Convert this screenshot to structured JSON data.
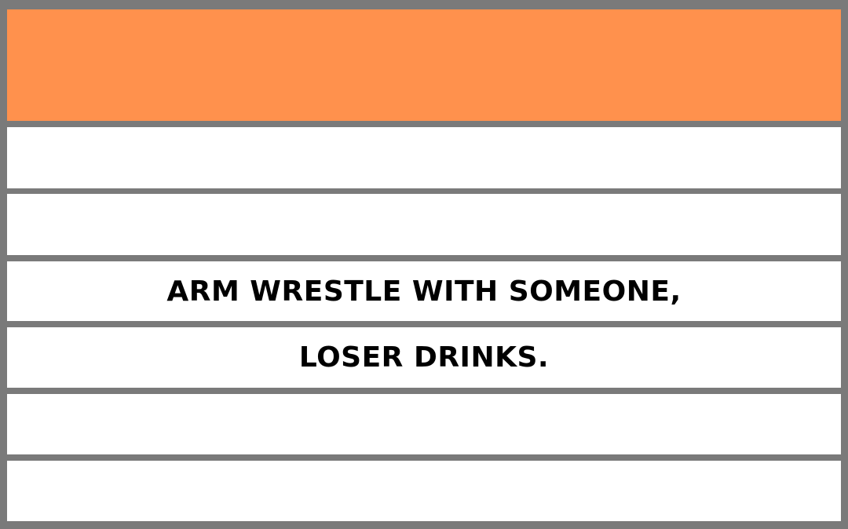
{
  "card": {
    "accent_color": "#ff914d",
    "border_color": "#7a7a7a",
    "lines": [
      "",
      "",
      "ARM WRESTLE WITH SOMEONE,",
      "LOSER DRINKS.",
      "",
      ""
    ]
  }
}
